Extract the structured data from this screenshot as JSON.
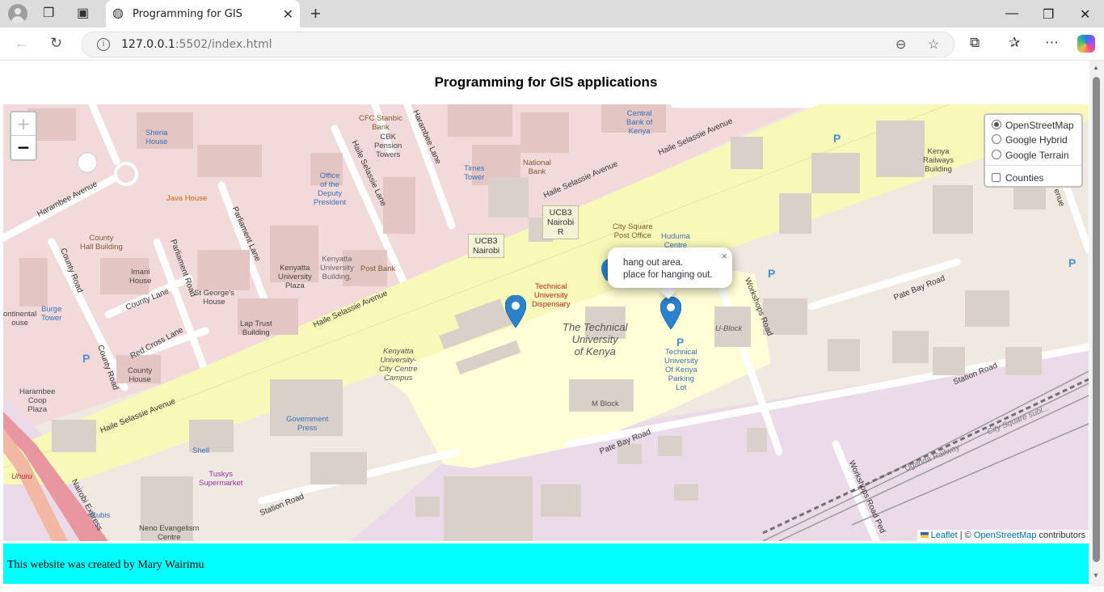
{
  "browser": {
    "tab_title": "Programming for GIS",
    "url_host": "127.0.0.1",
    "url_rest": ":5502/index.html",
    "icons": [
      "profile-icon",
      "workspaces-icon",
      "tab-actions-icon",
      "globe-icon",
      "close-icon",
      "plus-icon",
      "minimize-icon",
      "restore-icon",
      "window-close-icon",
      "back-icon",
      "refresh-icon",
      "info-icon",
      "zoom-out-icon",
      "star-icon",
      "extensions-icon",
      "favorites-icon",
      "more-icon",
      "copilot-icon"
    ]
  },
  "page": {
    "title": "Programming for GIS applications",
    "footer_text": "This website was created by Mary Wairimu"
  },
  "map": {
    "zoom_in": "+",
    "zoom_out": "−",
    "layers": {
      "base": [
        "OpenStreetMap",
        "Google Hybrid",
        "Google Terrain"
      ],
      "selected_base": "OpenStreetMap",
      "overlays": [
        "Counties"
      ]
    },
    "popup": {
      "line1": "hang out area.",
      "line2": "place for hanging out.",
      "close": "×"
    },
    "attribution": {
      "leaflet": "Leaflet",
      "sep": " | © ",
      "osm": "OpenStreetMap",
      "tail": " contributors"
    },
    "labels": {
      "sheria_house": "Sheria\nHouse",
      "harambee_avenue": "Harambee Avenue",
      "java_house": "Java House",
      "county_hall": "County\nHall Building",
      "imani_house": "Imani\nHouse",
      "county_lane": "County Lane",
      "st_georges": "St George's\nHouse",
      "lap_trust": "Lap Trust\nBuilding",
      "red_cross_lane": "Red Cross Lane",
      "county_house": "County\nHouse",
      "county_road": "County Road",
      "burge_tower": "Burge\nTower",
      "continental_house": "ontinental\nouse",
      "harambee_coop": "Harambee\nCoop\nPlaza",
      "office_deputy": "Office\nof the\nDeputy\nPresident",
      "haile_selassie_lane": "Haile Selassie Lane",
      "parliament_lane": "Parliament Lane",
      "parliament_road": "Parliament Road",
      "kenyatta_plaza": "Kenyatta\nUniversity\nPlaza",
      "kenyatta_building": "Kenyatta\nUniversity\nBuilding,",
      "post_bank": "Post Bank",
      "cfc_stanbic": "CFC Stanbic\nBank",
      "cbk_towers": "CBK\nPension\nTowers",
      "harambee_lane": "Harambee Lane",
      "times_tower": "Times\nTower",
      "national_bank": "National\nBank",
      "central_bank": "Central\nBank of\nKenya",
      "haile_selassie_avenue": "Haile Selassie Avenue",
      "city_square": "City Square\nPost Office",
      "huduma": "Huduma\nCentre",
      "ucb3_r": "UCB3\nNairobi\nR",
      "ucb3": "UCB3\nNairobi",
      "tu_dispensary": "Technical\nUniversity\nDispensary",
      "tu_kenya": "The Technical\nUniversity\nof Kenya",
      "ku_campus": "Kenyatta\nUniversity-\nCity Centre\nCampus",
      "m_block": "M Block",
      "u_block": "U-Block",
      "tuk_parking": "Technical\nUniversity\nOf Kenya\nParking\nLot",
      "workshops_road": "Workshops Road",
      "pate_bay_road": "Pate Bay Road",
      "station_road": "Station Road",
      "kenya_railways": "Kenya\nRailways\nBuilding",
      "government_press": "Government\nPress",
      "shell": "Shell",
      "tuskys": "Tuskys\nSupermarket",
      "rubis": "Rubis",
      "neno": "Neno Evangelism\nCentre",
      "uhuru": "Uhuru",
      "nairobi_express": "Nairobi Express",
      "uganda_railway": "Uganda Railway",
      "city_square_sub": "City Square subl...",
      "workshops_road_ped": "Workshops Road Ped",
      "enue": "enue",
      "p": "P"
    }
  }
}
